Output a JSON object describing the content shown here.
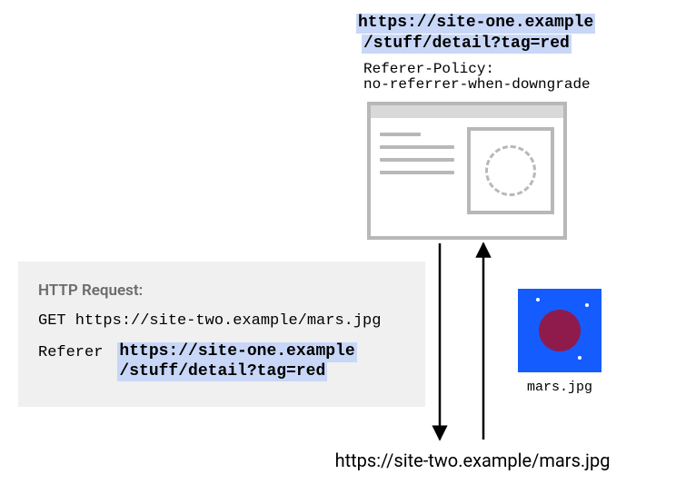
{
  "origin_url": {
    "line1": "https://site-one.example",
    "line2": "/stuff/detail?tag=red"
  },
  "policy": {
    "header": "Referer-Policy:",
    "value": "no-referrer-when-downgrade"
  },
  "request": {
    "title": "HTTP Request:",
    "method_line": "GET https://site-two.example/mars.jpg",
    "header_name": "Referer",
    "header_value_line1": "https://site-one.example",
    "header_value_line2": "/stuff/detail?tag=red"
  },
  "asset": {
    "caption": "mars.jpg"
  },
  "destination_url": "https://site-two.example/mars.jpg"
}
